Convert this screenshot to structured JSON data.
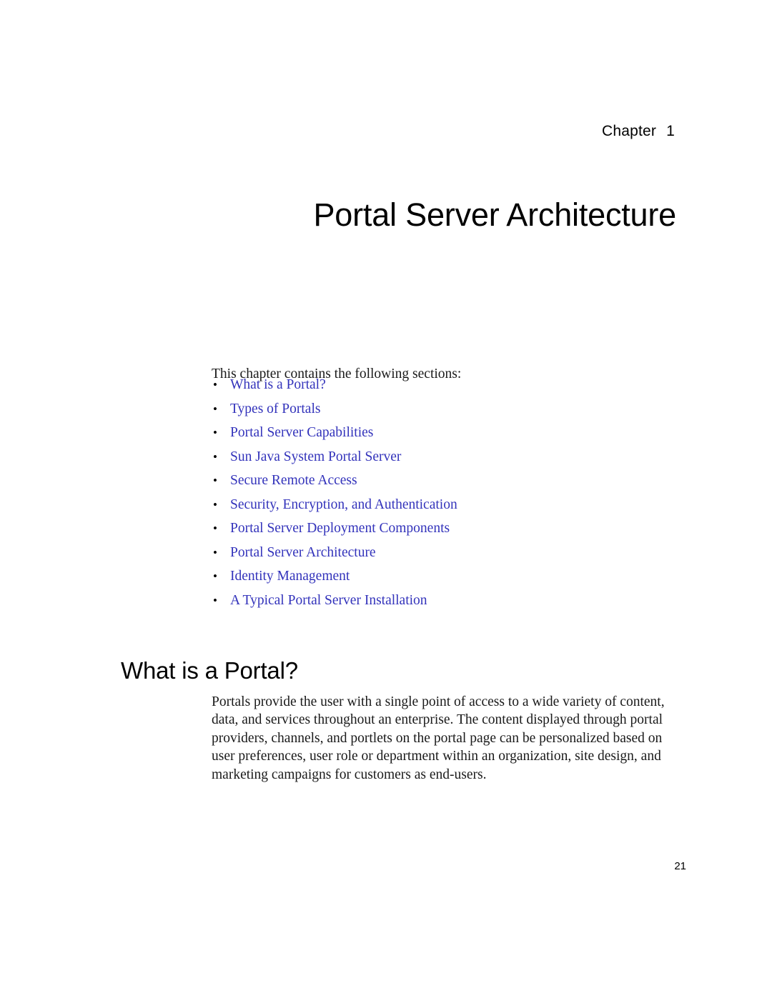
{
  "document": {
    "chapter_label": "Chapter",
    "chapter_number": "1",
    "chapter_title": "Portal Server Architecture",
    "page_number": "21"
  },
  "intro": {
    "text": "This chapter contains the following sections:"
  },
  "toc": {
    "bullet_glyph": "•",
    "items": [
      {
        "label": "What is a Portal?"
      },
      {
        "label": "Types of Portals"
      },
      {
        "label": "Portal Server Capabilities"
      },
      {
        "label": "Sun Java System Portal Server"
      },
      {
        "label": "Secure Remote Access"
      },
      {
        "label": "Security, Encryption, and Authentication"
      },
      {
        "label": "Portal Server Deployment Components"
      },
      {
        "label": "Portal Server Architecture"
      },
      {
        "label": "Identity Management"
      },
      {
        "label": "A Typical Portal Server Installation"
      }
    ]
  },
  "section": {
    "heading": "What is a Portal?",
    "paragraph": "Portals provide the user with a single point of access to a wide variety of content, data, and services throughout an enterprise. The content displayed through portal providers, channels, and portlets on the portal page can be personalized based on user preferences, user role or department within an organization, site design, and marketing campaigns for customers as end-users."
  },
  "colors": {
    "link": "#3333bb",
    "text": "#1a1a1a",
    "heading": "#000000",
    "page_background": "#ffffff"
  }
}
